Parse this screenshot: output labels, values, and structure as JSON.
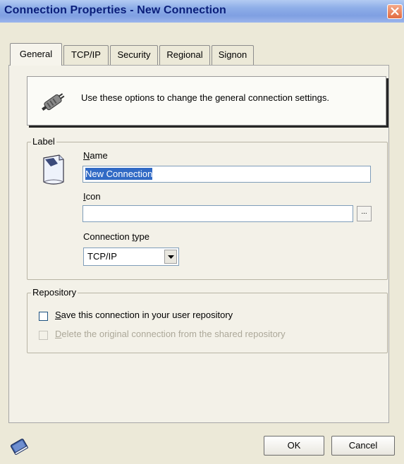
{
  "window": {
    "title": "Connection Properties - New Connection"
  },
  "tabs": [
    {
      "label": "General",
      "active": true
    },
    {
      "label": "TCP/IP",
      "active": false
    },
    {
      "label": "Security",
      "active": false
    },
    {
      "label": "Regional",
      "active": false
    },
    {
      "label": "Signon",
      "active": false
    }
  ],
  "info": {
    "icon": "plug-icon",
    "text": "Use these options to change the general connection settings."
  },
  "label_group": {
    "legend": "Label",
    "icon": "document-icon",
    "name_label_mnemonic": "N",
    "name_label_rest": "ame",
    "name_value": "New Connection",
    "icon_label_mnemonic": "I",
    "icon_label_rest": "con",
    "icon_value": "",
    "browse_label": "...",
    "type_label_pre": "Connection ",
    "type_label_mnemonic": "t",
    "type_label_rest": "ype",
    "type_value": "TCP/IP"
  },
  "repository_group": {
    "legend": "Repository",
    "save_mnemonic": "S",
    "save_rest": "ave this connection in your user repository",
    "save_checked": false,
    "delete_mnemonic": "D",
    "delete_rest": "elete the original connection from the shared repository",
    "delete_checked": false,
    "delete_enabled": false
  },
  "footer": {
    "help_icon": "help-book-icon",
    "ok_label": "OK",
    "cancel_label": "Cancel"
  },
  "colors": {
    "title_text": "#0a1e7a",
    "selection": "#316ac5",
    "close_button": "#e26b41"
  }
}
